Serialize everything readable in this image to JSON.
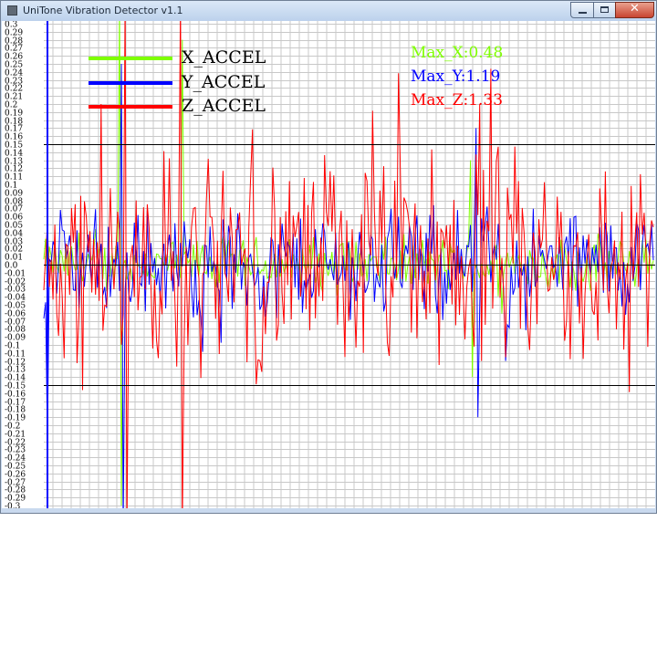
{
  "window": {
    "title": "UniTone Vibration Detector v1.1",
    "close_glyph": "✕"
  },
  "legend": [
    {
      "label": "X_ACCEL",
      "color": "#7fff00"
    },
    {
      "label": "Y_ACCEL",
      "color": "#0000ff"
    },
    {
      "label": "Z_ACCEL",
      "color": "#ff0000"
    }
  ],
  "max_readouts": {
    "x": "Max_X:0.48",
    "y": "Max_Y:1.19",
    "z": "Max_Z:1.33"
  },
  "chart_data": {
    "type": "line",
    "ylim": [
      -0.3,
      0.3
    ],
    "ytick_step": 0.01,
    "y_ticks": [
      "0.3",
      "0.29",
      "0.28",
      "0.27",
      "0.26",
      "0.25",
      "0.24",
      "0.23",
      "0.22",
      "0.21",
      "0.2",
      "0.19",
      "0.18",
      "0.17",
      "0.16",
      "0.15",
      "0.14",
      "0.13",
      "0.12",
      "0.11",
      "0.1",
      "0.09",
      "0.08",
      "0.07",
      "0.06",
      "0.05",
      "0.04",
      "0.03",
      "0.02",
      "0.01",
      "0.0",
      "-0.01",
      "-0.02",
      "-0.03",
      "-0.04",
      "-0.05",
      "-0.06",
      "-0.07",
      "-0.08",
      "-0.09",
      "-0.1",
      "-0.11",
      "-0.12",
      "-0.13",
      "-0.14",
      "-0.15",
      "-0.16",
      "-0.17",
      "-0.18",
      "-0.19",
      "-0.2",
      "-0.21",
      "-0.22",
      "-0.23",
      "-0.24",
      "-0.25",
      "-0.26",
      "-0.27",
      "-0.28",
      "-0.29",
      "-0.3"
    ],
    "reference_lines": [
      0.15,
      0.0,
      -0.15
    ],
    "grid": true,
    "series_colors": [
      "#7fff00",
      "#0000ff",
      "#ff0000"
    ],
    "series": [
      {
        "name": "X_ACCEL",
        "peak": 0.48,
        "noise_amplitude": 0.03
      },
      {
        "name": "Y_ACCEL",
        "peak": 1.19,
        "noise_amplitude": 0.06
      },
      {
        "name": "Z_ACCEL",
        "peak": 1.33,
        "noise_amplitude": 0.12
      }
    ]
  }
}
